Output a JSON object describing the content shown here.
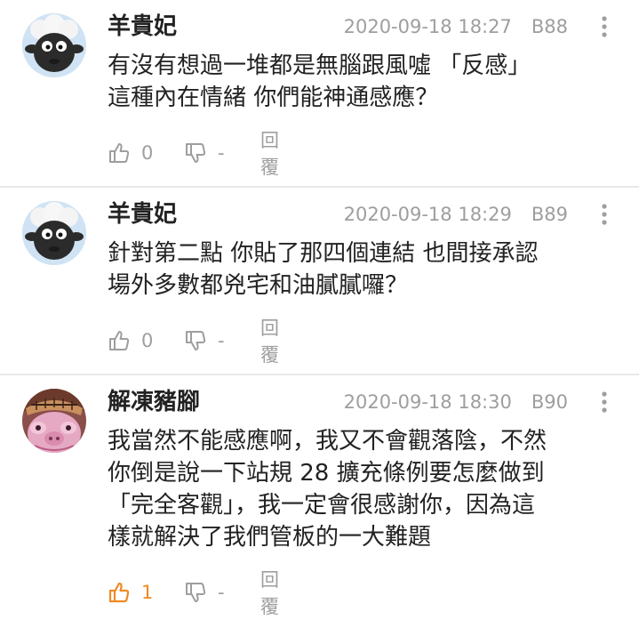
{
  "comments": [
    {
      "user": "羊貴妃",
      "timestamp": "2020-09-18 18:27",
      "floor": "B88",
      "text": "有沒有想過一堆都是無腦跟風噓 「反感」\n這種內在情緒 你們能神通感應？",
      "likes": "0",
      "dislikes": "-",
      "reply_label": "回覆",
      "avatar_icon": "sheep-avatar",
      "liked": false
    },
    {
      "user": "羊貴妃",
      "timestamp": "2020-09-18 18:29",
      "floor": "B89",
      "text": "針對第二點 你貼了那四個連結 也間接承認\n場外多數都兇宅和油膩膩囉？",
      "likes": "0",
      "dislikes": "-",
      "reply_label": "回覆",
      "avatar_icon": "sheep-avatar",
      "liked": false
    },
    {
      "user": "解凍豬腳",
      "timestamp": "2020-09-18 18:30",
      "floor": "B90",
      "text": "我當然不能感應啊，我又不會觀落陰，不然\n你倒是說一下站規 28 擴充條例要怎麼做到\n「完全客觀」，我一定會很感謝你，因為這\n樣就解決了我們管板的一大難題",
      "likes": "1",
      "dislikes": "-",
      "reply_label": "回覆",
      "avatar_icon": "pig-character-avatar",
      "liked": true
    }
  ],
  "colors": {
    "like_active": "#f08a24",
    "meta_gray": "#9e9e9e",
    "divider": "#e8e8e8"
  }
}
